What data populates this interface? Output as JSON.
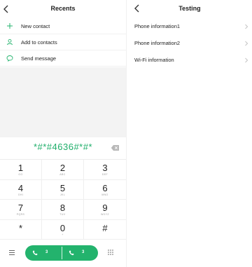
{
  "left": {
    "title": "Recents",
    "menu": [
      {
        "label": "New contact",
        "icon": "plus-icon"
      },
      {
        "label": "Add to contacts",
        "icon": "person-icon"
      },
      {
        "label": "Send message",
        "icon": "message-icon"
      }
    ],
    "dial_input": "*#*#4636#*#*",
    "keys": [
      {
        "digit": "1",
        "letters": "GO"
      },
      {
        "digit": "2",
        "letters": "ABC"
      },
      {
        "digit": "3",
        "letters": "DEF"
      },
      {
        "digit": "4",
        "letters": "GHI"
      },
      {
        "digit": "5",
        "letters": "JKL"
      },
      {
        "digit": "6",
        "letters": "MNO"
      },
      {
        "digit": "7",
        "letters": "PQRS"
      },
      {
        "digit": "8",
        "letters": "TUV"
      },
      {
        "digit": "9",
        "letters": "WXYZ"
      },
      {
        "digit": "*",
        "letters": ""
      },
      {
        "digit": "0",
        "letters": "+"
      },
      {
        "digit": "#",
        "letters": ""
      }
    ],
    "call_buttons": [
      {
        "sim": "3"
      },
      {
        "sim": "3"
      }
    ]
  },
  "right": {
    "title": "Testing",
    "items": [
      {
        "label": "Phone information1"
      },
      {
        "label": "Phone information2"
      },
      {
        "label": "Wi-Fi information"
      }
    ]
  },
  "colors": {
    "accent": "#23b36d",
    "digits": "#1fae6a",
    "gray_area": "#f3f3f3"
  }
}
